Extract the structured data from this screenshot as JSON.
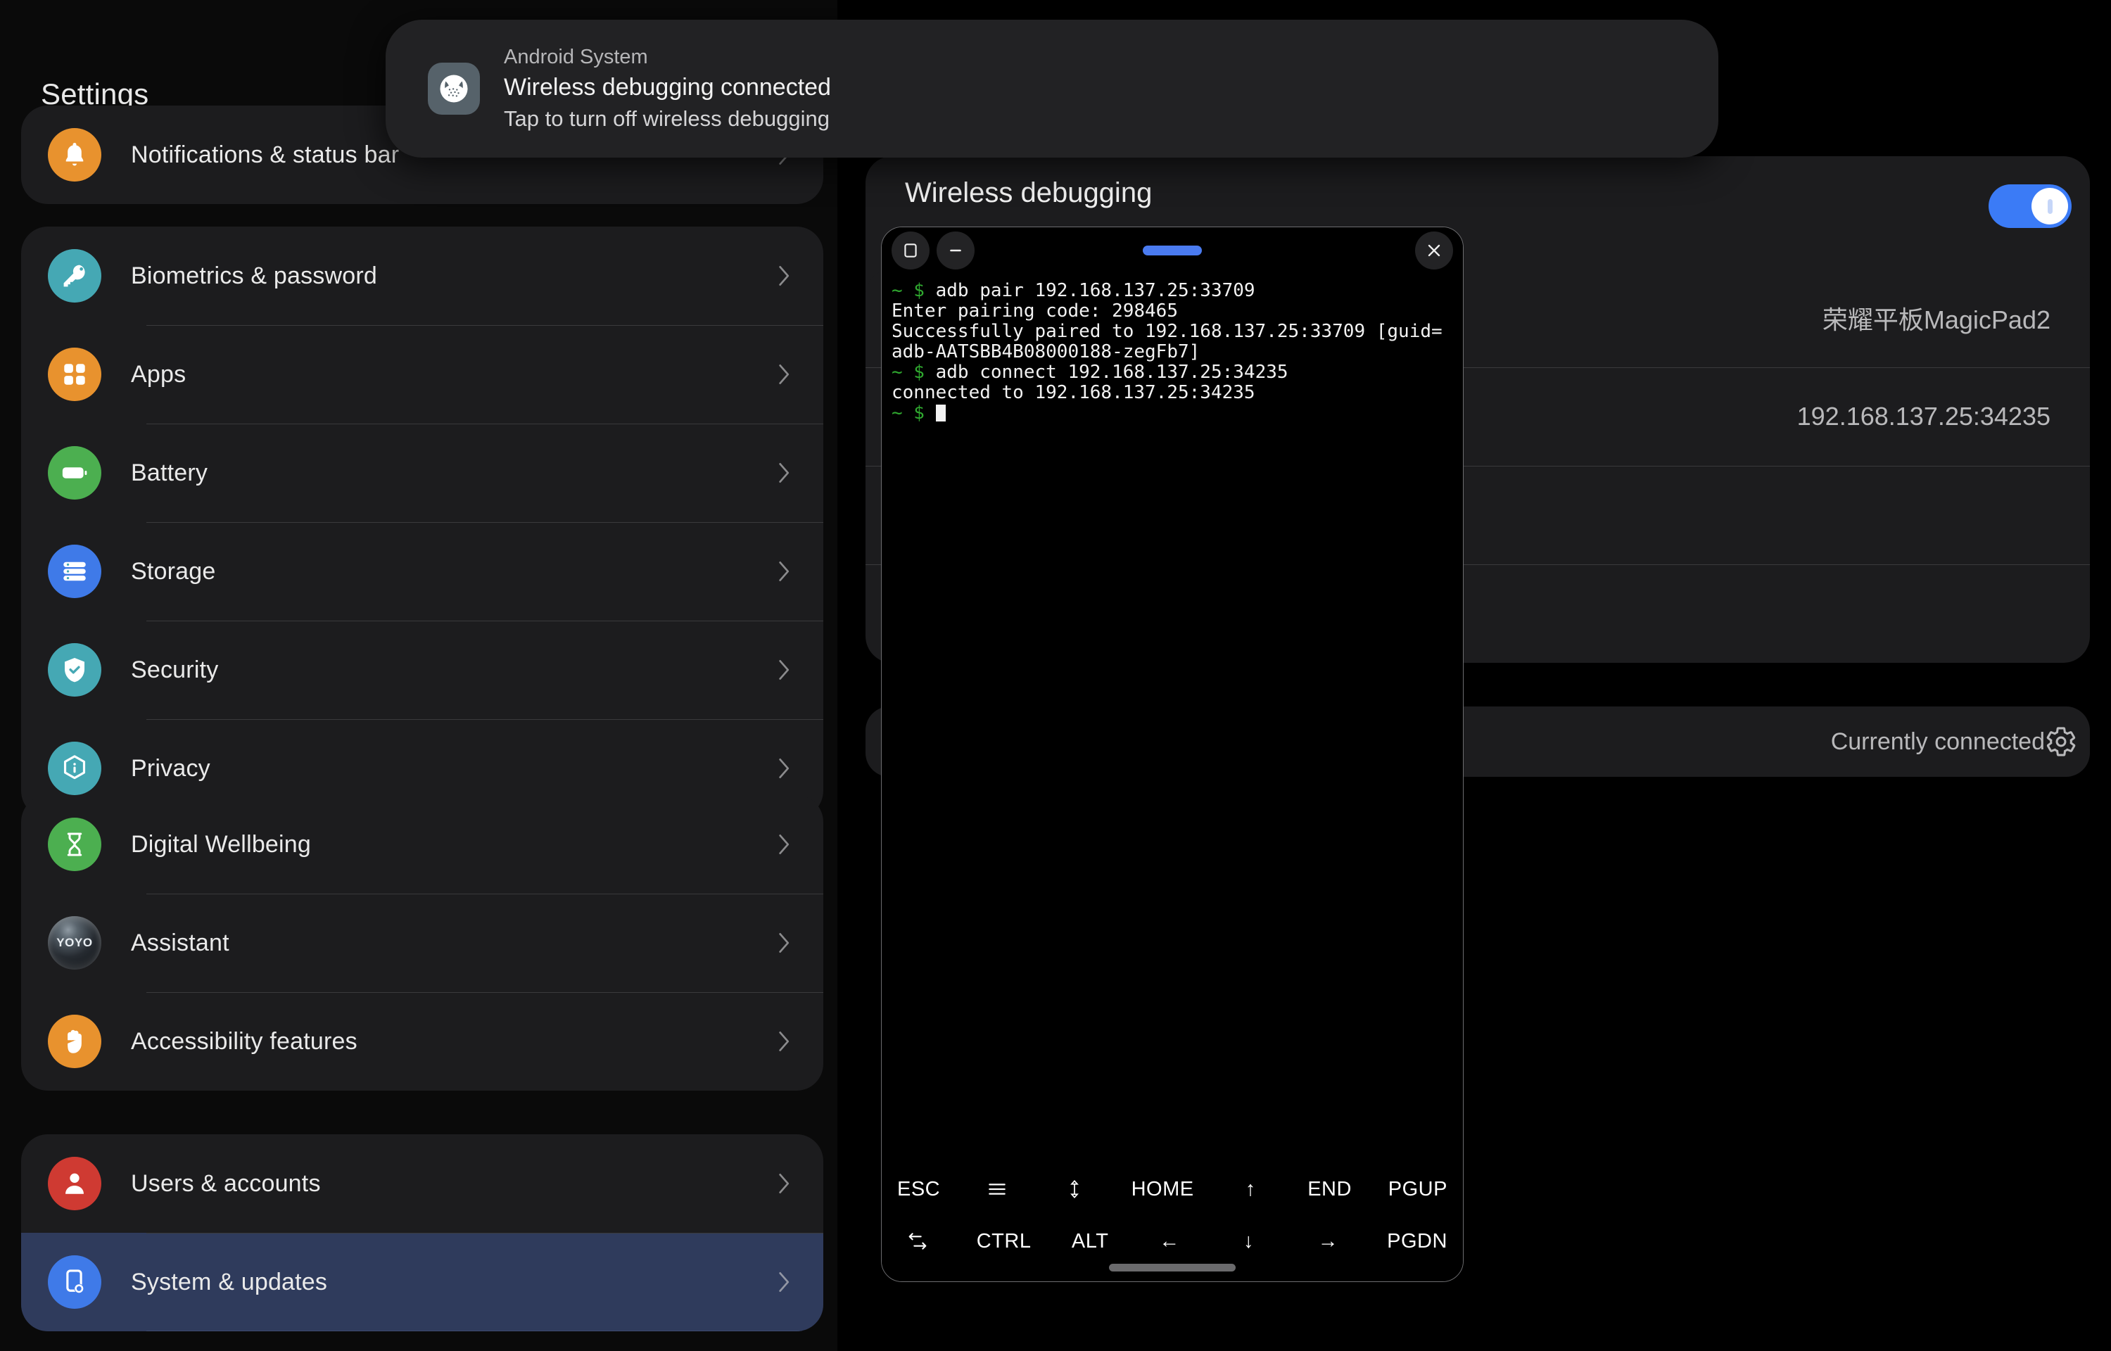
{
  "settings": {
    "title": "Settings",
    "groups": [
      {
        "items": [
          {
            "label": "Notifications & status bar",
            "icon": "bell-icon",
            "color": "#e8922e",
            "selected": false
          }
        ]
      },
      {
        "items": [
          {
            "label": "Biometrics & password",
            "icon": "key-icon",
            "color": "#45a8b4",
            "selected": false
          },
          {
            "label": "Apps",
            "icon": "apps-grid-icon",
            "color": "#e8922e",
            "selected": false
          },
          {
            "label": "Battery",
            "icon": "battery-icon",
            "color": "#4caf50",
            "selected": false
          },
          {
            "label": "Storage",
            "icon": "storage-stack-icon",
            "color": "#3f7ae8",
            "selected": false
          },
          {
            "label": "Security",
            "icon": "shield-check-icon",
            "color": "#45a8b4",
            "selected": false
          },
          {
            "label": "Privacy",
            "icon": "privacy-hexagon-icon",
            "color": "#45a8b4",
            "selected": false
          }
        ]
      },
      {
        "items": [
          {
            "label": "Digital Wellbeing",
            "icon": "hourglass-icon",
            "color": "#4caf50",
            "selected": false
          },
          {
            "label": "Assistant",
            "icon": "yoyo-orb-icon",
            "color": "orb",
            "badge": "YOYO",
            "selected": false
          },
          {
            "label": "Accessibility features",
            "icon": "hand-icon",
            "color": "#e8922e",
            "selected": false
          }
        ]
      },
      {
        "items": [
          {
            "label": "Users & accounts",
            "icon": "person-icon",
            "color": "#cf3a32",
            "selected": false
          },
          {
            "label": "System & updates",
            "icon": "device-gear-icon",
            "color": "#3f7ae8",
            "selected": true
          }
        ]
      }
    ]
  },
  "detail": {
    "header_title": "Wireless debugging",
    "toggle_on": true,
    "rows": [
      {
        "value": "荣耀平板MagicPad2"
      },
      {
        "value": "192.168.137.25:34235"
      },
      {
        "value": ""
      },
      {
        "value": ""
      }
    ],
    "connected_label": "Currently connected",
    "gear_icon": "gear-icon"
  },
  "terminal": {
    "titlebar": {
      "window_icon": "tablet-window-icon",
      "minimize_icon": "minimize-icon",
      "drag_handle": "drag-handle",
      "close_icon": "close-icon"
    },
    "lines": [
      {
        "prompt": "~ $ ",
        "text": "adb pair 192.168.137.25:33709"
      },
      {
        "prompt": "",
        "text": "Enter pairing code: 298465"
      },
      {
        "prompt": "",
        "text": "Successfully paired to 192.168.137.25:33709 [guid=adb-AATSBB4B08000188-zegFb7]"
      },
      {
        "prompt": "~ $ ",
        "text": "adb connect 192.168.137.25:34235"
      },
      {
        "prompt": "",
        "text": "connected to 192.168.137.25:34235"
      },
      {
        "prompt": "~ $ ",
        "text": ""
      }
    ],
    "keys_row1": [
      {
        "label": "ESC",
        "icon": null
      },
      {
        "label": "",
        "icon": "menu-hamburger-icon"
      },
      {
        "label": "",
        "icon": "updown-arrow-icon"
      },
      {
        "label": "HOME",
        "icon": null
      },
      {
        "label": "↑",
        "icon": null
      },
      {
        "label": "END",
        "icon": null
      },
      {
        "label": "PGUP",
        "icon": null
      }
    ],
    "keys_row2": [
      {
        "label": "",
        "icon": "tab-icon"
      },
      {
        "label": "CTRL",
        "icon": null
      },
      {
        "label": "ALT",
        "icon": null
      },
      {
        "label": "←",
        "icon": null
      },
      {
        "label": "↓",
        "icon": null
      },
      {
        "label": "→",
        "icon": null
      },
      {
        "label": "PGDN",
        "icon": null
      }
    ]
  },
  "notification": {
    "app_name": "Android System",
    "title": "Wireless debugging connected",
    "subtitle": "Tap to turn off wireless debugging",
    "icon": "android-head-icon"
  }
}
